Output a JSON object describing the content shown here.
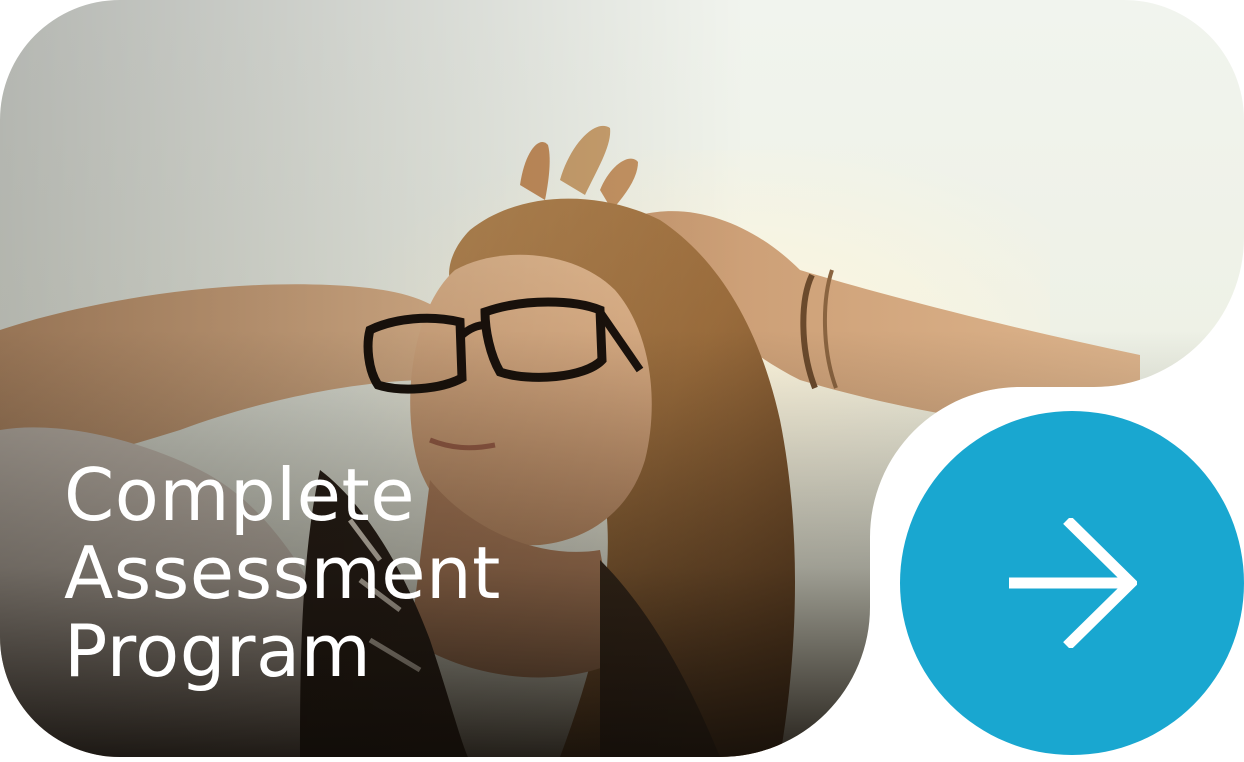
{
  "card": {
    "title_lines": [
      "Complete",
      "Assessment",
      "Program"
    ],
    "image_subject": "woman-with-glasses-sunlight-photo"
  },
  "action": {
    "icon": "arrow-right-icon"
  },
  "colors": {
    "accent": "#19a7d0",
    "title_text": "#ffffff",
    "sky": "#eef3ec",
    "warm_light": "#f3e6c5",
    "shadow": "#120d08"
  }
}
